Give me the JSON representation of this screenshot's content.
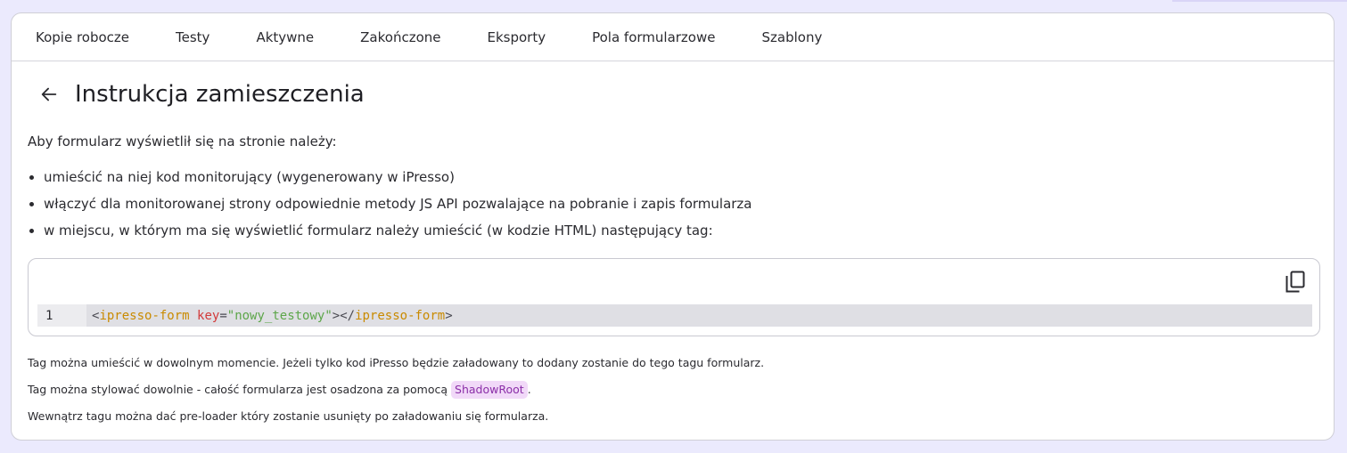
{
  "tabs": [
    {
      "label": "Kopie robocze"
    },
    {
      "label": "Testy"
    },
    {
      "label": "Aktywne"
    },
    {
      "label": "Zakończone"
    },
    {
      "label": "Eksporty"
    },
    {
      "label": "Pola formularzowe"
    },
    {
      "label": "Szablony"
    }
  ],
  "page": {
    "title": "Instrukcja zamieszczenia",
    "back_icon": "arrow-left-icon"
  },
  "intro": "Aby formularz wyświetlił się na stronie należy:",
  "bullets": [
    "umieścić na niej kod monitorujący (wygenerowany w iPresso)",
    "włączyć dla monitorowanej strony odpowiednie metody JS API pozwalające na pobranie i zapis formularza",
    "w miejscu, w którym ma się wyświetlić formularz należy umieścić (w kodzie HTML) następujący tag:"
  ],
  "code": {
    "line_number": "1",
    "tokens": {
      "open_lt": "<",
      "tag_open": "ipresso-form",
      "attr": "key",
      "eq": "=",
      "value": "\"nowy_testowy\"",
      "close_mid": "></",
      "tag_close": "ipresso-form",
      "close_gt": ">"
    },
    "copy_icon": "copy-icon"
  },
  "notes": {
    "note1": "Tag można umieścić w dowolnym momencie. Jeżeli tylko kod iPresso będzie załadowany to dodany zostanie do tego tagu formularz.",
    "note2_before": "Tag można stylować dowolnie - całość formularza jest osadzona za pomocą",
    "note2_chip": "ShadowRoot",
    "note2_after": ".",
    "note3": "Wewnątrz tagu można dać pre-loader który zostanie usunięty po załadowaniu się formularza."
  },
  "colors": {
    "background": "#ebeafd",
    "tag": "#c98a00",
    "attr": "#d23a3a",
    "string": "#5da64a",
    "chip_bg": "#f1d9f8",
    "chip_text": "#8b2fa8"
  }
}
